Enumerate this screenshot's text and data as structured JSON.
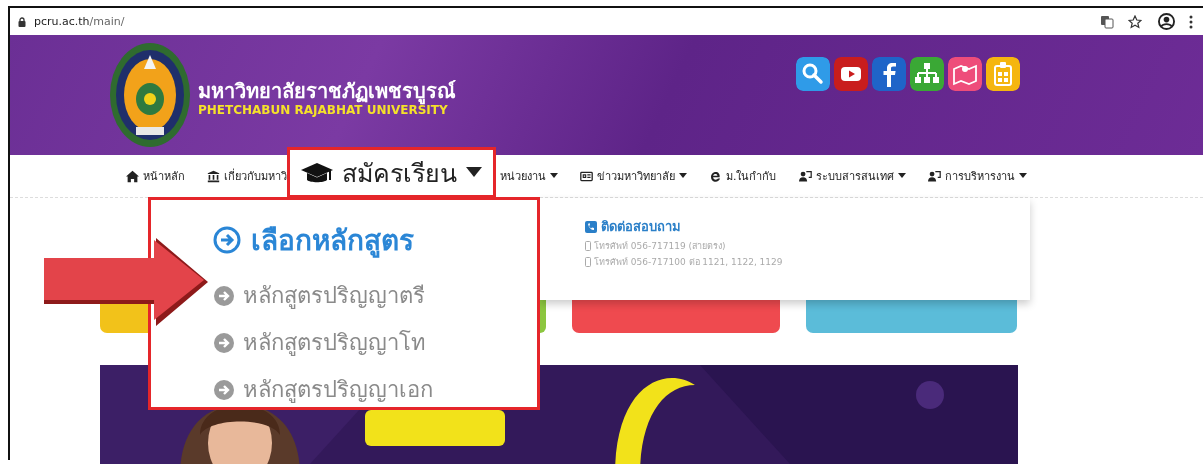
{
  "browser": {
    "url_host": "pcru.ac.th",
    "url_path": "/main/"
  },
  "header": {
    "title_th": "มหาวิทยาลัยราชภัฏเพชรบูรณ์",
    "title_en": "PHETCHABUN RAJABHAT UNIVERSITY",
    "shortcuts": [
      {
        "kind": "search"
      },
      {
        "kind": "video"
      },
      {
        "kind": "facebook"
      },
      {
        "kind": "sitemap"
      },
      {
        "kind": "map"
      },
      {
        "kind": "badge"
      }
    ]
  },
  "nav": [
    {
      "kind": "home",
      "label": "หน้าหลัก",
      "caret": false,
      "highlighted": false
    },
    {
      "kind": "bank",
      "label": "เกี่ยวกับมหาวิ",
      "caret": false,
      "highlighted": false
    },
    {
      "kind": "cap",
      "label": "สมัครเรียน",
      "caret": true,
      "highlighted": true
    },
    {
      "kind": "plain",
      "label": "หน่วยงาน",
      "caret": true,
      "highlighted": false
    },
    {
      "kind": "news",
      "label": "ข่าวมหาวิทยาลัย",
      "caret": true,
      "highlighted": false
    },
    {
      "kind": "ie",
      "label": "ม.ในกำกับ",
      "caret": false,
      "highlighted": false
    },
    {
      "kind": "people",
      "label": "ระบบสารสนเทศ",
      "caret": true,
      "highlighted": false
    },
    {
      "kind": "people",
      "label": "การบริหารงาน",
      "caret": true,
      "highlighted": false
    }
  ],
  "dropdown": {
    "heading": "เลือกหลักสูตร",
    "items": [
      "หลักสูตรปริญญาตรี",
      "หลักสูตรปริญญาโท",
      "หลักสูตรปริญญาเอก"
    ],
    "contact": {
      "heading": "ติดต่อสอบถาม",
      "lines": [
        "โทรศัพท์ 056-717119 (สายตรง)",
        "โทรศัพท์ 056-717100 ต่อ 1121, 1122, 1129"
      ]
    }
  },
  "tiles": [
    {
      "color": "#f2c21a"
    },
    {
      "color": "#8cc63f"
    },
    {
      "color": "#ef4a4f"
    },
    {
      "color": "#5bbcd9"
    }
  ]
}
